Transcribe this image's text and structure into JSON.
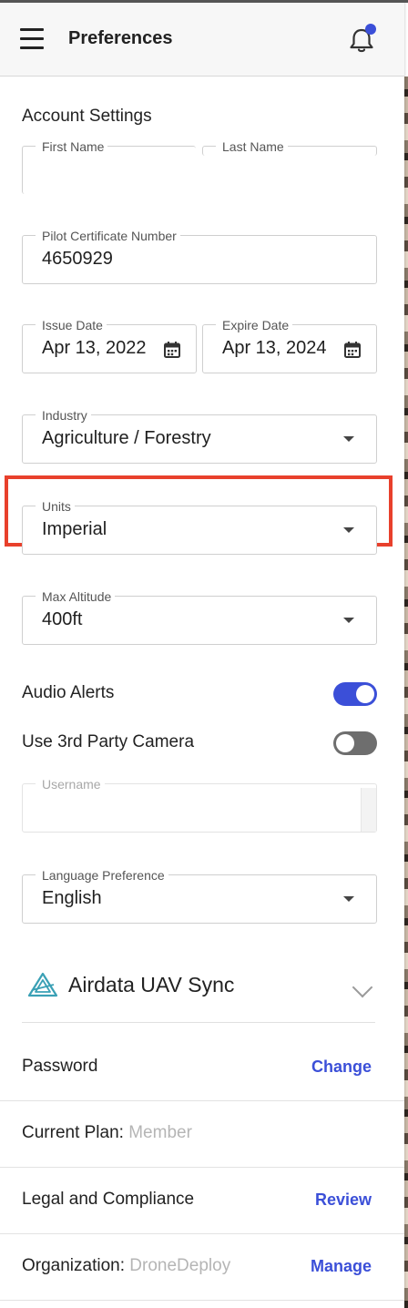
{
  "header": {
    "title": "Preferences",
    "menu_icon": "hamburger-menu-icon",
    "notification_icon": "bell-icon",
    "notification_dot_color": "#3b4fd8"
  },
  "account": {
    "section_title": "Account Settings",
    "first_name": {
      "label": "First Name",
      "value": ""
    },
    "last_name": {
      "label": "Last Name",
      "value": ""
    },
    "pilot_cert": {
      "label": "Pilot Certificate Number",
      "value": "4650929"
    },
    "issue_date": {
      "label": "Issue Date",
      "value": "Apr 13, 2022"
    },
    "expire_date": {
      "label": "Expire Date",
      "value": "Apr 13, 2024"
    },
    "industry": {
      "label": "Industry",
      "value": "Agriculture / Forestry"
    },
    "units": {
      "label": "Units",
      "value": "Imperial"
    },
    "max_altitude": {
      "label": "Max Altitude",
      "value": "400ft"
    },
    "audio_alerts": {
      "label": "Audio Alerts",
      "on": true
    },
    "third_party_camera": {
      "label": "Use 3rd Party Camera",
      "on": false
    },
    "username": {
      "label": "Username",
      "value": ""
    },
    "language": {
      "label": "Language Preference",
      "value": "English"
    }
  },
  "airdata": {
    "label": "Airdata UAV Sync",
    "logo_color": "#3aa0b5"
  },
  "rows": {
    "password": {
      "label": "Password",
      "action": "Change"
    },
    "plan": {
      "label": "Current Plan:",
      "value": "Member"
    },
    "legal": {
      "label": "Legal and Compliance",
      "action": "Review"
    },
    "organization": {
      "label": "Organization:",
      "value": "DroneDeploy",
      "action": "Manage"
    }
  },
  "colors": {
    "accent": "#3b4fd8",
    "highlight": "#e8402c"
  }
}
